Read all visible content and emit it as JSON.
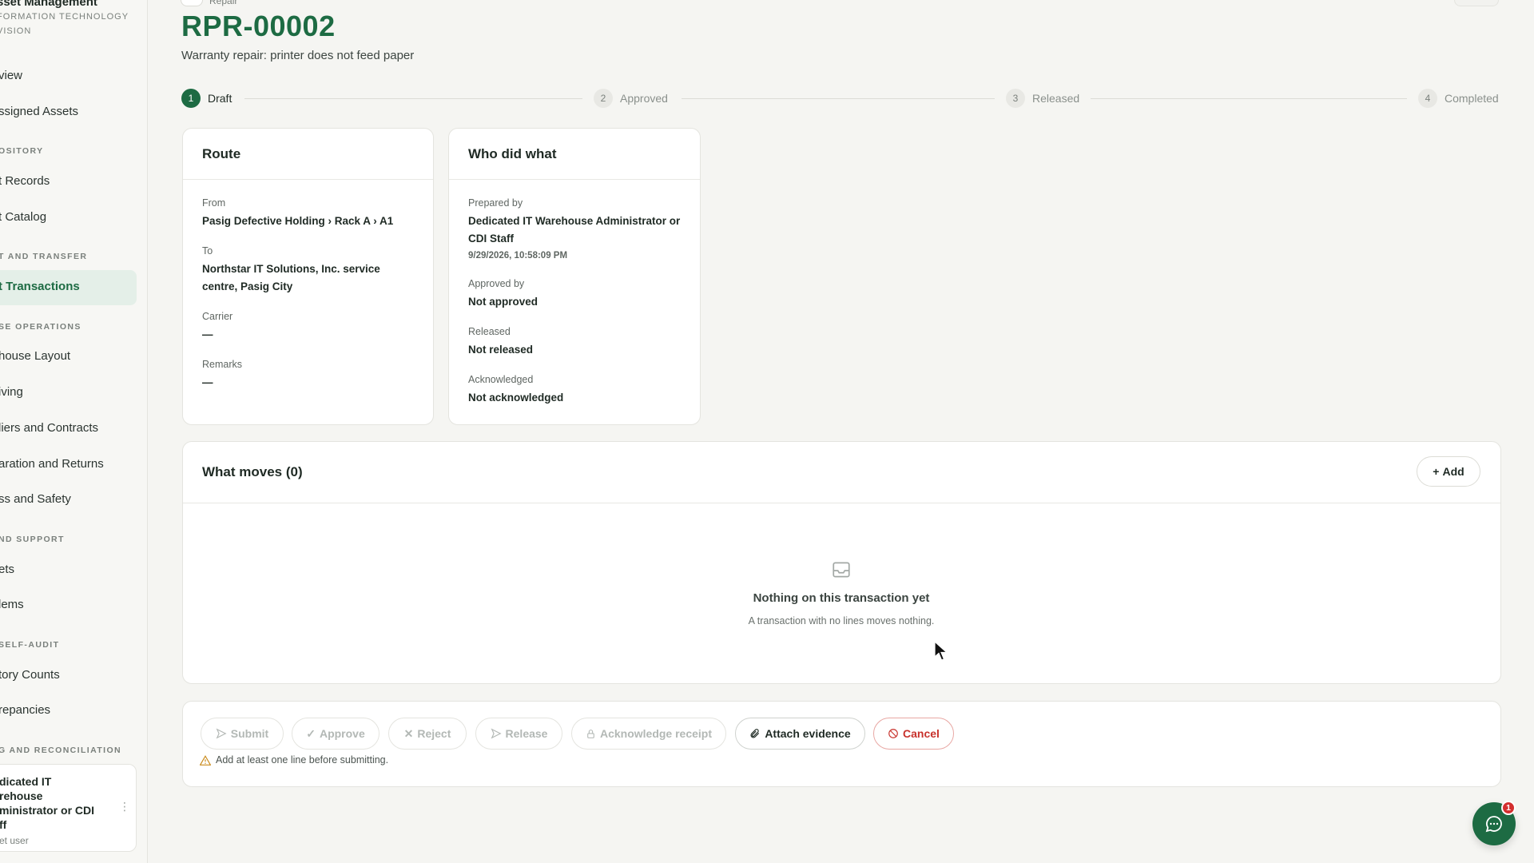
{
  "sidebar": {
    "brand_title": "sset Management",
    "brand_subtitle": "FORMATION TECHNOLOGY VISION",
    "items": [
      {
        "label": "view"
      },
      {
        "label": "ssigned Assets"
      },
      {
        "section": "OSITORY"
      },
      {
        "label": "t Records"
      },
      {
        "label": "t Catalog"
      },
      {
        "section": "T AND TRANSFER"
      },
      {
        "label": "t Transactions",
        "active": true
      },
      {
        "section": "SE OPERATIONS"
      },
      {
        "label": "house Layout"
      },
      {
        "label": "iving"
      },
      {
        "label": "liers and Contracts"
      },
      {
        "label": "aration and Returns"
      },
      {
        "label": "ss and Safety"
      },
      {
        "section": "ND SUPPORT"
      },
      {
        "label": "ets"
      },
      {
        "label": "lems"
      },
      {
        "section": "SELF-AUDIT"
      },
      {
        "label": "tory Counts"
      },
      {
        "label": "repancies"
      },
      {
        "section": "G AND RECONCILIATION"
      }
    ],
    "user": {
      "name": "dicated IT rehouse ministrator or CDI ff",
      "role": "et user"
    }
  },
  "header": {
    "breadcrumb": "Repair",
    "title": "RPR-00002",
    "subtitle": "Warranty repair: printer does not feed paper"
  },
  "stepper": [
    {
      "num": "1",
      "label": "Draft",
      "active": true
    },
    {
      "num": "2",
      "label": "Approved",
      "active": false
    },
    {
      "num": "3",
      "label": "Released",
      "active": false
    },
    {
      "num": "4",
      "label": "Completed",
      "active": false
    }
  ],
  "route": {
    "title": "Route",
    "from_label": "From",
    "from_value": "Pasig Defective Holding › Rack A › A1",
    "to_label": "To",
    "to_value": "Northstar IT Solutions, Inc. service centre, Pasig City",
    "carrier_label": "Carrier",
    "carrier_value": "—",
    "remarks_label": "Remarks",
    "remarks_value": "—"
  },
  "who": {
    "title": "Who did what",
    "prepared_label": "Prepared by",
    "prepared_value": "Dedicated IT Warehouse Administrator or CDI Staff",
    "prepared_time": "9/29/2026, 10:58:09 PM",
    "approved_label": "Approved by",
    "approved_value": "Not approved",
    "released_label": "Released",
    "released_value": "Not released",
    "ack_label": "Acknowledged",
    "ack_value": "Not acknowledged"
  },
  "moves": {
    "title": "What moves (0)",
    "add_label": "Add",
    "empty_title": "Nothing on this transaction yet",
    "empty_subtitle": "A transaction with no lines moves nothing."
  },
  "actions": {
    "submit": "Submit",
    "approve": "Approve",
    "reject": "Reject",
    "release": "Release",
    "acknowledge": "Acknowledge receipt",
    "attach": "Attach evidence",
    "cancel": "Cancel",
    "warning": "Add at least one line before submitting."
  },
  "chat": {
    "badge": "1"
  },
  "colors": {
    "brand": "#1d6b43",
    "danger": "#c8322c",
    "badge": "#d32f2f"
  }
}
